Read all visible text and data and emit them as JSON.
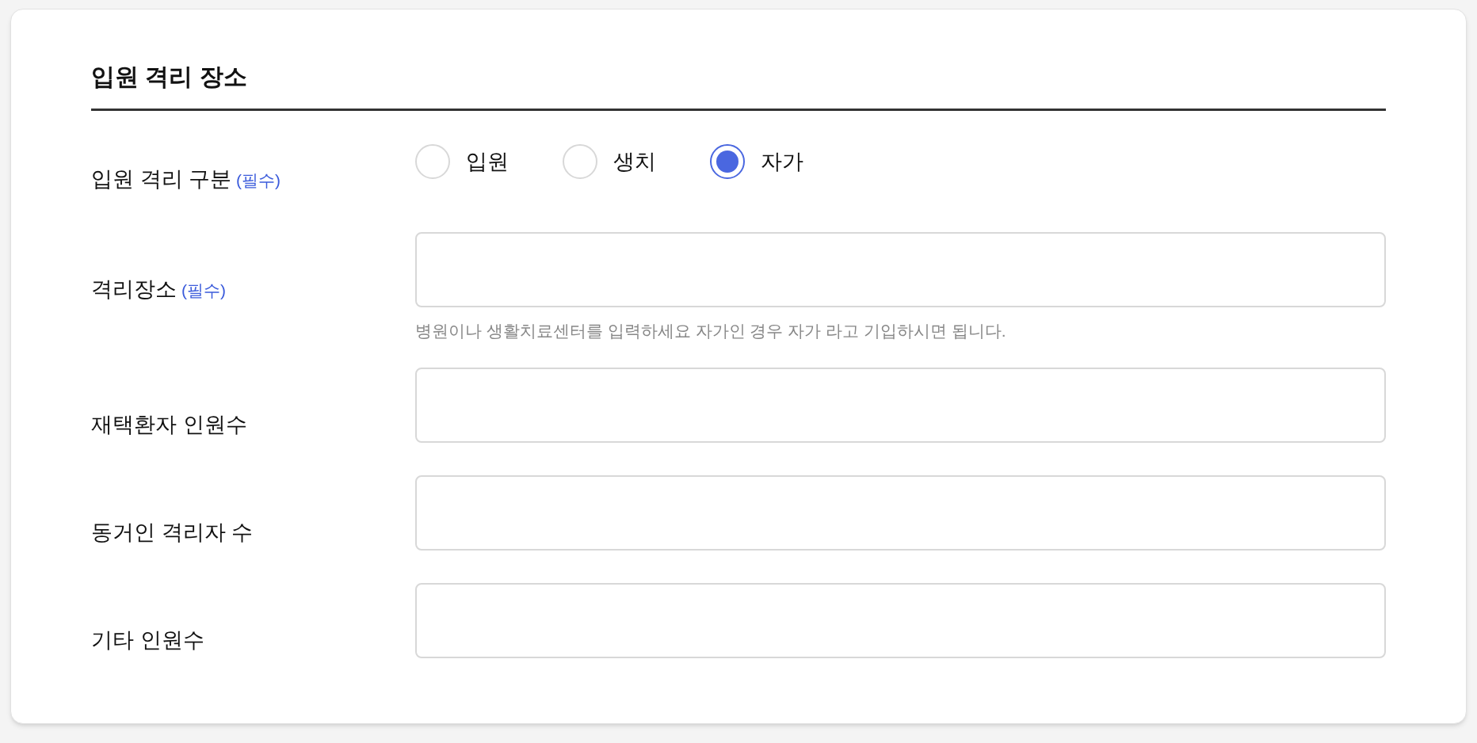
{
  "section": {
    "title": "입원 격리 장소"
  },
  "fields": [
    {
      "kind": "radio",
      "label": "입원 격리 구분",
      "required": "(필수)",
      "options": [
        {
          "label": "입원",
          "selected": false
        },
        {
          "label": "생치",
          "selected": false
        },
        {
          "label": "자가",
          "selected": true
        }
      ]
    },
    {
      "kind": "text",
      "label": "격리장소",
      "required": "(필수)",
      "help": "병원이나 생활치료센터를 입력하세요 자가인 경우 자가 라고 기입하시면 됩니다."
    },
    {
      "kind": "text",
      "label": "재택환자 인원수"
    },
    {
      "kind": "text",
      "label": "동거인 격리자 수"
    },
    {
      "kind": "text",
      "label": "기타 인원수"
    }
  ]
}
